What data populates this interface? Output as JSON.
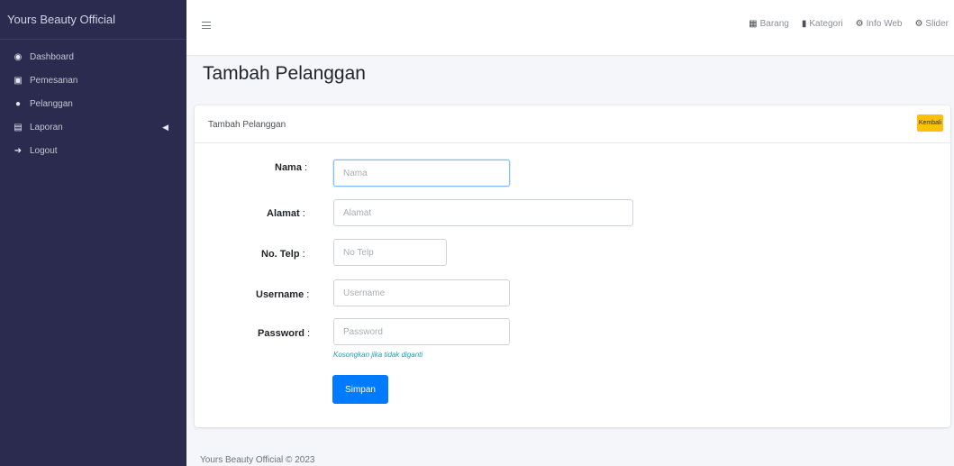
{
  "sidebar": {
    "brand": "Yours Beauty Official",
    "items": [
      {
        "label": "Dashboard",
        "icon": "dashboard-icon"
      },
      {
        "label": "Pemesanan",
        "icon": "cart-icon"
      },
      {
        "label": "Pelanggan",
        "icon": "users-icon"
      },
      {
        "label": "Laporan",
        "icon": "print-icon"
      },
      {
        "label": "Logout",
        "icon": "logout-icon"
      }
    ]
  },
  "topbar": {
    "links": [
      {
        "label": "Barang",
        "icon": "box-icon"
      },
      {
        "label": "Kategori",
        "icon": "file-icon"
      },
      {
        "label": "Info Web",
        "icon": "gear-icon"
      },
      {
        "label": "Slider",
        "icon": "gear-icon"
      }
    ]
  },
  "page": {
    "title": "Tambah Pelanggan"
  },
  "card": {
    "title": "Tambah Pelanggan",
    "back_label": "Kembali"
  },
  "form": {
    "nama_label": "Nama",
    "nama_placeholder": "Nama",
    "alamat_label": "Alamat",
    "alamat_placeholder": "Alamat",
    "telp_label": "No. Telp",
    "telp_placeholder": "No Telp",
    "username_label": "Username",
    "username_placeholder": "Username",
    "password_label": "Password",
    "password_placeholder": "Password",
    "password_hint": "Kosongkan jika tidak diganti",
    "colon": ":",
    "save_label": "Simpan"
  },
  "footer": {
    "text": "Yours Beauty Official © 2023"
  },
  "colors": {
    "sidebar_bg": "#2b2b4f",
    "primary": "#007bff",
    "warning": "#ffc107",
    "hint": "#17a2b8"
  }
}
